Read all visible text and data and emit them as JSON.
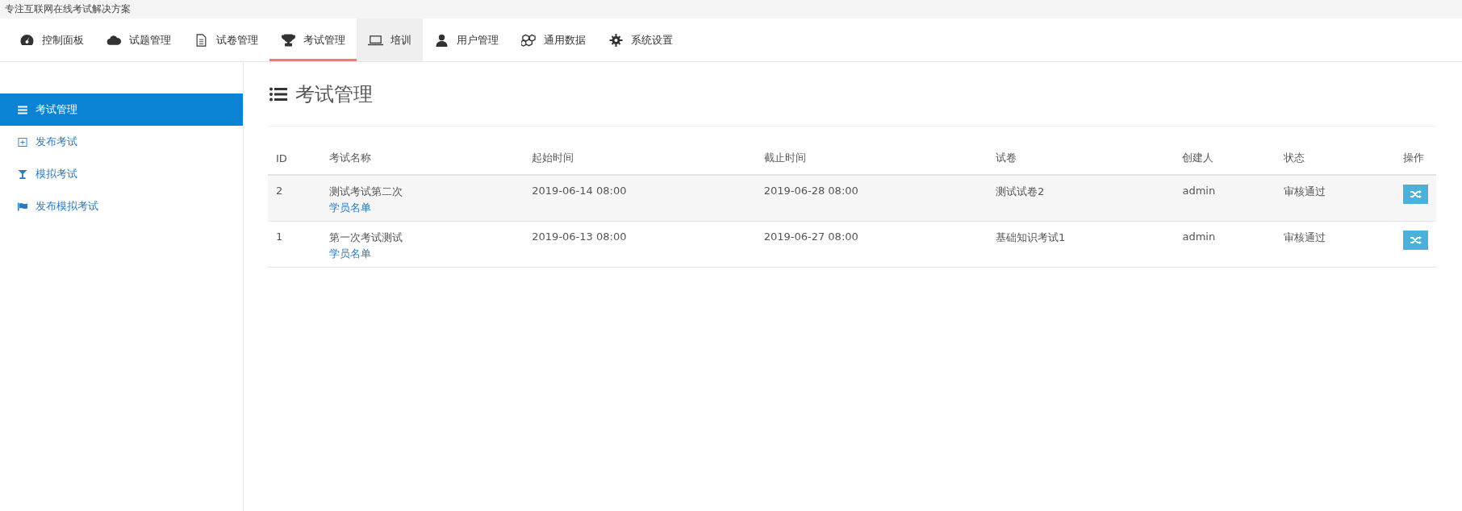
{
  "banner": {
    "text": "专注互联网在线考试解决方案"
  },
  "nav": [
    {
      "label": "控制面板",
      "selected": false,
      "hovered": false
    },
    {
      "label": "试题管理",
      "selected": false,
      "hovered": false
    },
    {
      "label": "试卷管理",
      "selected": false,
      "hovered": false
    },
    {
      "label": "考试管理",
      "selected": true,
      "hovered": false
    },
    {
      "label": "培训",
      "selected": false,
      "hovered": true
    },
    {
      "label": "用户管理",
      "selected": false,
      "hovered": false
    },
    {
      "label": "通用数据",
      "selected": false,
      "hovered": false
    },
    {
      "label": "系统设置",
      "selected": false,
      "hovered": false
    }
  ],
  "sidebar": {
    "items": [
      {
        "label": "考试管理",
        "selected": true
      },
      {
        "label": "发布考试",
        "selected": false
      },
      {
        "label": "模拟考试",
        "selected": false
      },
      {
        "label": "发布模拟考试",
        "selected": false
      }
    ]
  },
  "page_title": "考试管理",
  "table": {
    "columns": [
      "ID",
      "考试名称",
      "起始时间",
      "截止时间",
      "试卷",
      "创建人",
      "状态",
      "操作"
    ],
    "rows": [
      {
        "id": "2",
        "name": "测试考试第二次",
        "link": "学员名单",
        "start": "2019-06-14 08:00",
        "end": "2019-06-28 08:00",
        "paper": "测试试卷2",
        "creator": "admin",
        "status": "审核通过"
      },
      {
        "id": "1",
        "name": "第一次考试测试",
        "link": "学员名单",
        "start": "2019-06-13 08:00",
        "end": "2019-06-27 08:00",
        "paper": "基础知识考试1",
        "creator": "admin",
        "status": "审核通过"
      }
    ]
  }
}
